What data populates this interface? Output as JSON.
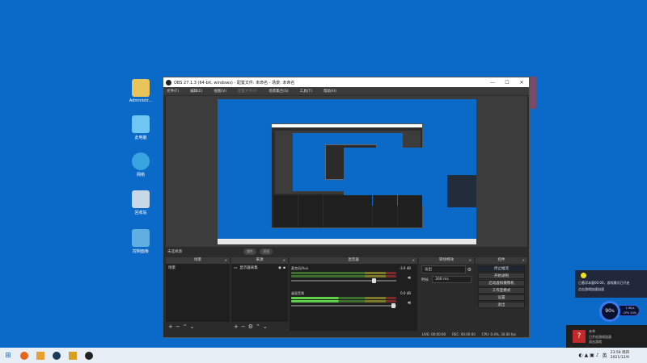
{
  "desktop": {
    "icons": [
      {
        "label": "Administr...",
        "icon": "user-folder-icon"
      },
      {
        "label": "此电脑",
        "icon": "computer-icon"
      },
      {
        "label": "网络",
        "icon": "network-icon"
      },
      {
        "label": "回收站",
        "icon": "recycle-bin-icon"
      },
      {
        "label": "控制面板",
        "icon": "control-panel-icon"
      }
    ]
  },
  "obs": {
    "title": "OBS 27.1.3 (64-bit, windows) - 配置文件: 未命名 - 场景: 未命名",
    "menu": [
      "文件(F)",
      "编辑(E)",
      "视图(V)",
      "配置文件(P)",
      "场景集合(S)",
      "工具(T)",
      "帮助(H)"
    ],
    "scene_bar": {
      "label": "未选择源",
      "btn1": "属性",
      "btn2": "滤镜"
    },
    "docks": {
      "scenes": {
        "title": "场景",
        "items": [
          "场景"
        ]
      },
      "sources": {
        "title": "来源",
        "items": [
          "显示器采集"
        ]
      },
      "mixer": {
        "title": "混音器",
        "channels": [
          {
            "name": "麦克风/Aux",
            "db": "-3.9 dB"
          },
          {
            "name": "桌面音频",
            "db": "0.0 dB"
          }
        ]
      },
      "transitions": {
        "title": "转场特效",
        "type": "淡出",
        "duration_label": "时长",
        "duration": "300 ms"
      },
      "controls": {
        "title": "控件",
        "buttons": [
          "停止推流",
          "开始录制",
          "启动虚拟摄像机",
          "工作室模式",
          "设置",
          "退出"
        ]
      }
    },
    "status": {
      "live": "LIVE: 00:00:00",
      "rec": "REC: 00:00:00",
      "cpu": "CPU: 0.4%, 30.00 fps"
    }
  },
  "notifications": {
    "line1": "已悬浮本窗00:00，游戏模式已开启",
    "line2": "点击游戏加速加速",
    "speed_value": "90",
    "speed_unit": "%",
    "speed_top": "1.9K/s",
    "speed_bottom": "CPU 20%",
    "toast_title": "未命",
    "toast_line1": "已开启游戏加速",
    "toast_line2": "双击游戏"
  },
  "taskbar": {
    "time": "23:58 周四",
    "date": "2021/12/9",
    "lang": "英"
  }
}
